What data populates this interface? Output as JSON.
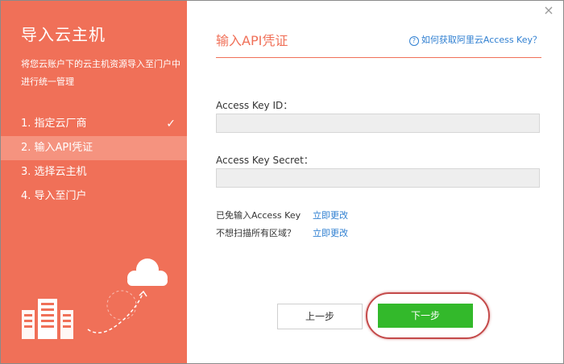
{
  "sidebar": {
    "title": "导入云主机",
    "description": "将您云账户下的云主机资源导入至门户中进行统一管理",
    "steps": [
      {
        "label": "1. 指定云厂商",
        "done": true
      },
      {
        "label": "2. 输入API凭证",
        "active": true
      },
      {
        "label": "3. 选择云主机"
      },
      {
        "label": "4. 导入至门户"
      }
    ],
    "check_glyph": "✓"
  },
  "window": {
    "close_glyph": "×"
  },
  "main": {
    "title": "输入API凭证",
    "help_icon": "?",
    "help_link": "如何获取阿里云Access Key？",
    "fields": {
      "access_key_id": {
        "label": "Access Key ID：",
        "value": ""
      },
      "access_key_secret": {
        "label": "Access Key Secret：",
        "value": ""
      }
    },
    "options": [
      {
        "label": "已免输入Access Key",
        "link": "立即更改"
      },
      {
        "label": "不想扫描所有区域？",
        "link": "立即更改"
      }
    ],
    "buttons": {
      "prev": "上一步",
      "next": "下一步"
    }
  },
  "colors": {
    "accent": "#f07058",
    "active_step": "#f5937f",
    "link": "#2f7fd1",
    "primary_button": "#33b92b",
    "highlight_ring": "#c44a4a"
  }
}
